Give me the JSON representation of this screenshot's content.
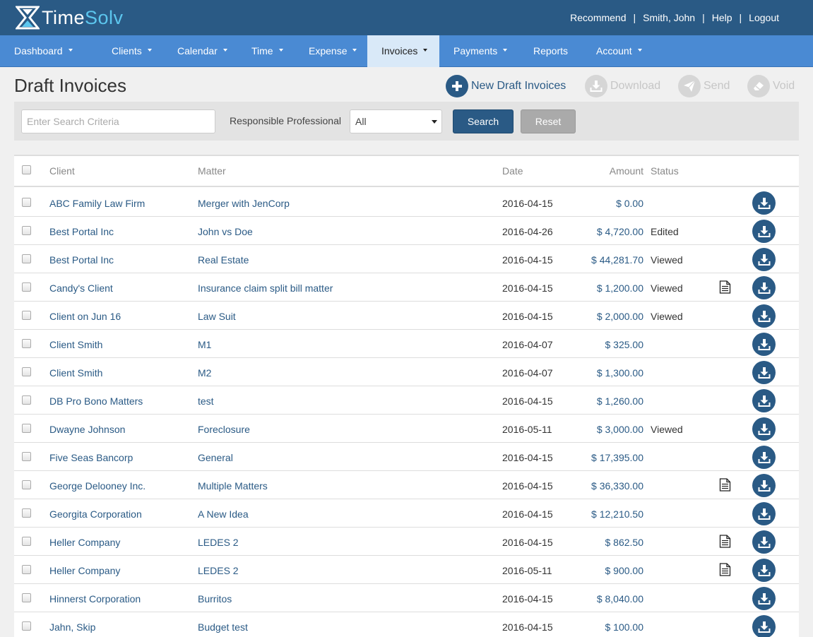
{
  "app": {
    "logo_time": "Time",
    "logo_solv": "Solv",
    "colors": {
      "header": "#2a5a85",
      "nav": "#4a8ad3",
      "accent_light": "#5cc6ee"
    }
  },
  "toplinks": [
    {
      "label": "Recommend"
    },
    {
      "label": "Smith, John"
    },
    {
      "label": "Help"
    },
    {
      "label": "Logout"
    }
  ],
  "nav": [
    {
      "label": "Dashboard",
      "dropdown": true
    },
    {
      "label": "Clients",
      "dropdown": true
    },
    {
      "label": "Calendar",
      "dropdown": true
    },
    {
      "label": "Time",
      "dropdown": true
    },
    {
      "label": "Expense",
      "dropdown": true
    },
    {
      "label": "Invoices",
      "dropdown": true,
      "active": true
    },
    {
      "label": "Payments",
      "dropdown": true
    },
    {
      "label": "Reports",
      "dropdown": false
    },
    {
      "label": "Account",
      "dropdown": true
    }
  ],
  "page": {
    "title": "Draft Invoices"
  },
  "actions": {
    "new_draft": "New Draft Invoices",
    "download": "Download",
    "send": "Send",
    "void": "Void"
  },
  "search": {
    "placeholder": "Enter Search Criteria",
    "value": "",
    "rp_label": "Responsible Professional",
    "rp_selected": "All",
    "search_label": "Search",
    "reset_label": "Reset"
  },
  "table": {
    "headers": {
      "client": "Client",
      "matter": "Matter",
      "date": "Date",
      "amount": "Amount",
      "status": "Status"
    },
    "rows": [
      {
        "client": "ABC Family Law Firm",
        "matter": "Merger with JenCorp",
        "date": "2016-04-15",
        "amount": "$ 0.00",
        "status": "",
        "note": false
      },
      {
        "client": "Best Portal Inc",
        "matter": "John vs Doe",
        "date": "2016-04-26",
        "amount": "$ 4,720.00",
        "status": "Edited",
        "note": false
      },
      {
        "client": "Best Portal Inc",
        "matter": "Real Estate",
        "date": "2016-04-15",
        "amount": "$ 44,281.70",
        "status": "Viewed",
        "note": false
      },
      {
        "client": "Candy's Client",
        "matter": "Insurance claim split bill matter",
        "date": "2016-04-15",
        "amount": "$ 1,200.00",
        "status": "Viewed",
        "note": true
      },
      {
        "client": "Client on Jun 16",
        "matter": "Law Suit",
        "date": "2016-04-15",
        "amount": "$ 2,000.00",
        "status": "Viewed",
        "note": false
      },
      {
        "client": "Client Smith",
        "matter": "M1",
        "date": "2016-04-07",
        "amount": "$ 325.00",
        "status": "",
        "note": false
      },
      {
        "client": "Client Smith",
        "matter": "M2",
        "date": "2016-04-07",
        "amount": "$ 1,300.00",
        "status": "",
        "note": false
      },
      {
        "client": "DB Pro Bono Matters",
        "matter": "test",
        "date": "2016-04-15",
        "amount": "$ 1,260.00",
        "status": "",
        "note": false
      },
      {
        "client": "Dwayne Johnson",
        "matter": "Foreclosure",
        "date": "2016-05-11",
        "amount": "$ 3,000.00",
        "status": "Viewed",
        "note": false
      },
      {
        "client": "Five Seas Bancorp",
        "matter": "General",
        "date": "2016-04-15",
        "amount": "$ 17,395.00",
        "status": "",
        "note": false
      },
      {
        "client": "George Delooney Inc.",
        "matter": "Multiple Matters",
        "date": "2016-04-15",
        "amount": "$ 36,330.00",
        "status": "",
        "note": true
      },
      {
        "client": "Georgita Corporation",
        "matter": "A New Idea",
        "date": "2016-04-15",
        "amount": "$ 12,210.50",
        "status": "",
        "note": false
      },
      {
        "client": "Heller Company",
        "matter": "LEDES 2",
        "date": "2016-04-15",
        "amount": "$ 862.50",
        "status": "",
        "note": true
      },
      {
        "client": "Heller Company",
        "matter": "LEDES 2",
        "date": "2016-05-11",
        "amount": "$ 900.00",
        "status": "",
        "note": true
      },
      {
        "client": "Hinnerst Corporation",
        "matter": "Burritos",
        "date": "2016-04-15",
        "amount": "$ 8,040.00",
        "status": "",
        "note": false
      },
      {
        "client": "Jahn, Skip",
        "matter": "Budget test",
        "date": "2016-04-15",
        "amount": "$ 100.00",
        "status": "",
        "note": false
      }
    ]
  }
}
